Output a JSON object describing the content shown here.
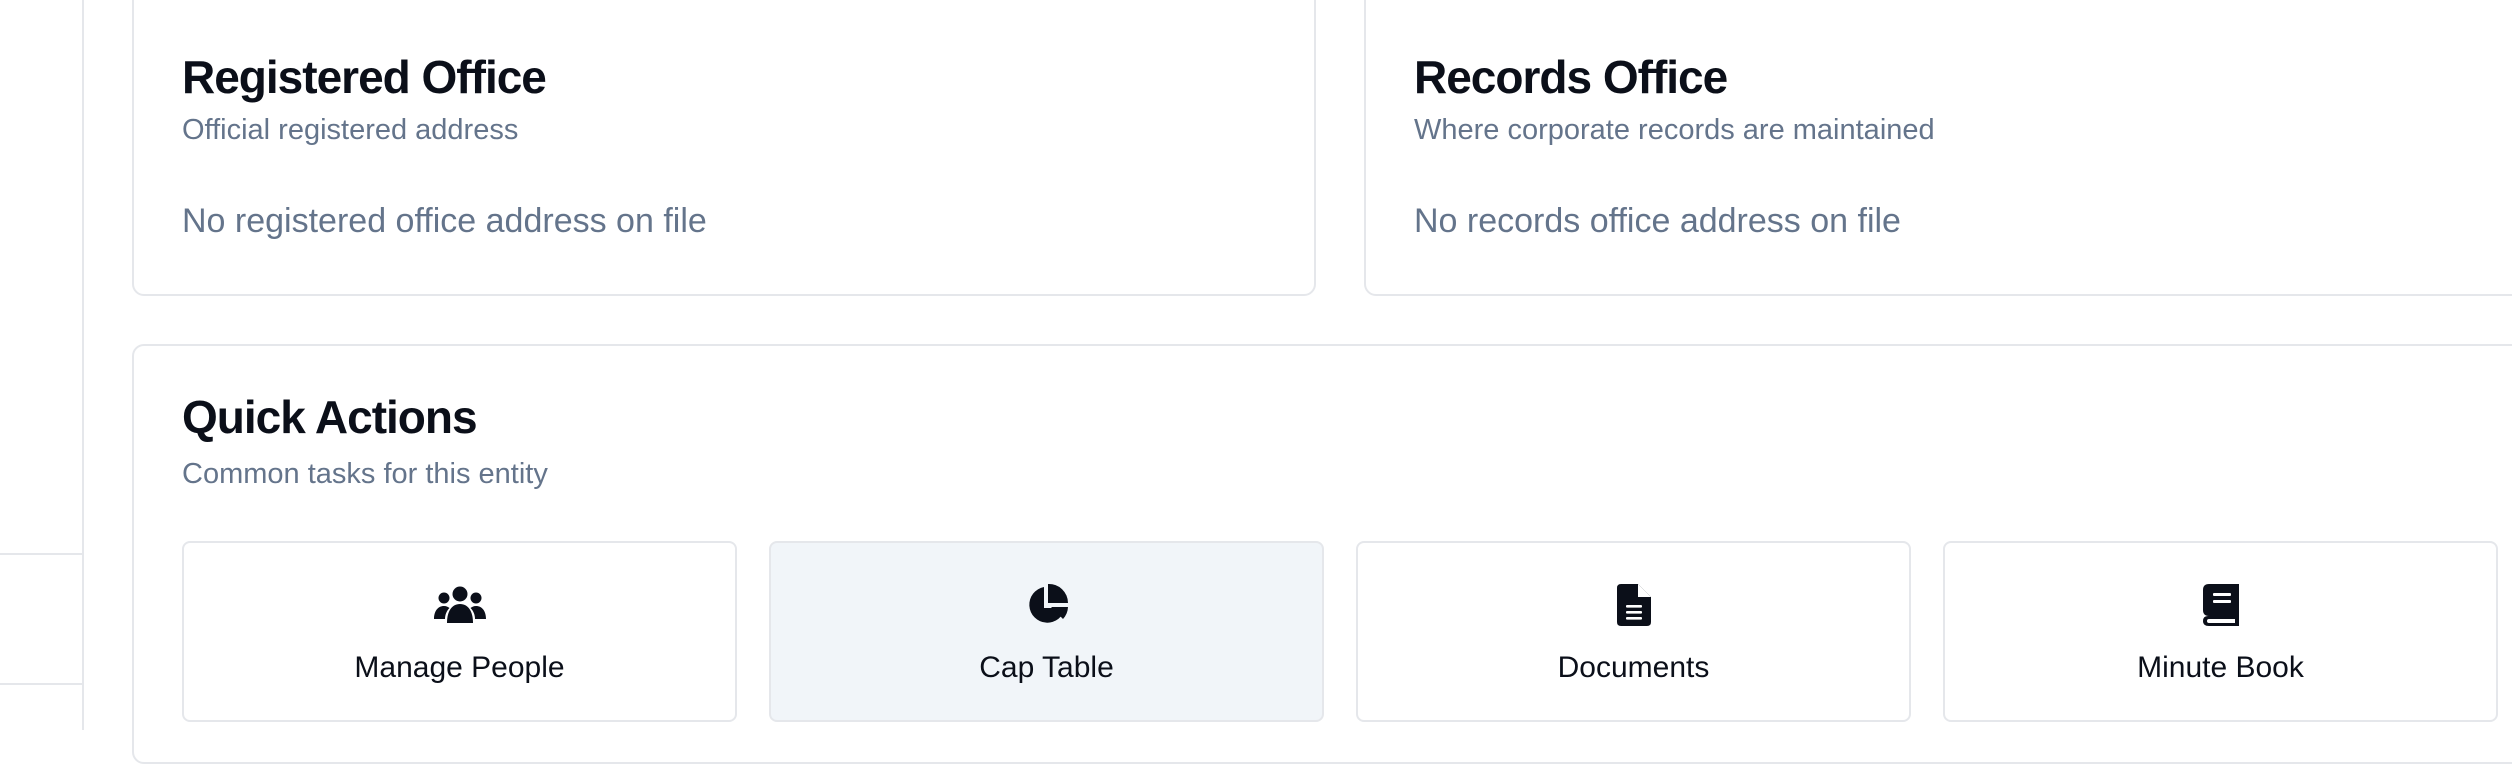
{
  "registered_office": {
    "title": "Registered Office",
    "subtitle": "Official registered address",
    "empty_text": "No registered office address on file"
  },
  "records_office": {
    "title": "Records Office",
    "subtitle": "Where corporate records are maintained",
    "empty_text": "No records office address on file"
  },
  "quick_actions": {
    "title": "Quick Actions",
    "subtitle": "Common tasks for this entity",
    "items": [
      {
        "label": "Manage People",
        "icon": "users-icon"
      },
      {
        "label": "Cap Table",
        "icon": "pie-chart-icon"
      },
      {
        "label": "Documents",
        "icon": "document-icon"
      },
      {
        "label": "Minute Book",
        "icon": "book-icon"
      }
    ]
  },
  "colors": {
    "title_text": "#0b0f19",
    "muted_text": "#64748b",
    "border": "#e5e7eb",
    "hover_bg": "#f1f5f9"
  }
}
